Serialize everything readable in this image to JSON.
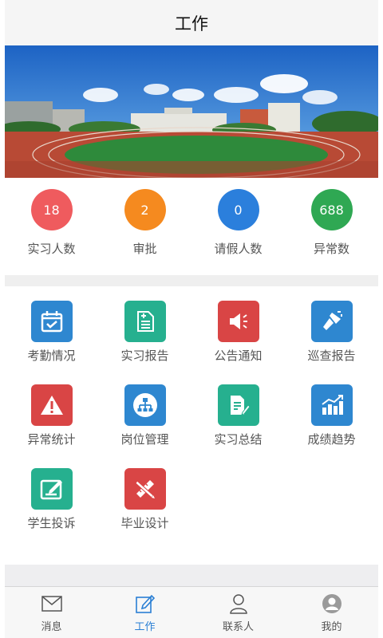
{
  "header": {
    "title": "工作"
  },
  "stats": [
    {
      "value": "18",
      "label": "实习人数",
      "color": "#ef5b5e"
    },
    {
      "value": "2",
      "label": "审批",
      "color": "#f58a1f"
    },
    {
      "value": "0",
      "label": "请假人数",
      "color": "#2b7fdc"
    },
    {
      "value": "688",
      "label": "异常数",
      "color": "#2fa853"
    }
  ],
  "grid": [
    {
      "label": "考勤情况",
      "icon": "calendar-check-icon",
      "color": "#2e87d0"
    },
    {
      "label": "实习报告",
      "icon": "document-add-icon",
      "color": "#26b08f"
    },
    {
      "label": "公告通知",
      "icon": "megaphone-icon",
      "color": "#d94545"
    },
    {
      "label": "巡查报告",
      "icon": "flashlight-icon",
      "color": "#2e87d0"
    },
    {
      "label": "异常统计",
      "icon": "warning-icon",
      "color": "#d94545"
    },
    {
      "label": "岗位管理",
      "icon": "org-chart-icon",
      "color": "#2e87d0"
    },
    {
      "label": "实习总结",
      "icon": "document-edit-icon",
      "color": "#26b08f"
    },
    {
      "label": "成绩趋势",
      "icon": "bar-chart-trend-icon",
      "color": "#2e87d0"
    },
    {
      "label": "学生投诉",
      "icon": "edit-box-icon",
      "color": "#26b08f"
    },
    {
      "label": "毕业设计",
      "icon": "ruler-pencil-icon",
      "color": "#d94545"
    }
  ],
  "tabbar": {
    "active": "工作",
    "items": [
      {
        "label": "消息",
        "icon": "envelope-icon"
      },
      {
        "label": "工作",
        "icon": "edit-icon"
      },
      {
        "label": "联系人",
        "icon": "person-icon"
      },
      {
        "label": "我的",
        "icon": "avatar-icon"
      }
    ]
  }
}
